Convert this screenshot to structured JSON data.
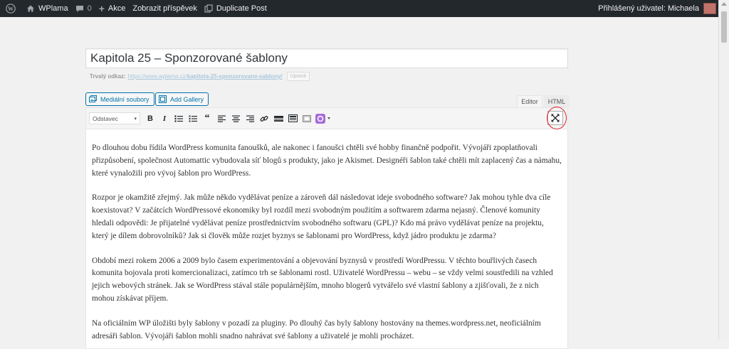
{
  "adminbar": {
    "site_name": "WPlama",
    "comments_count": "0",
    "new_label": "Akce",
    "view_post": "Zobrazit příspěvek",
    "duplicate": "Duplicate Post",
    "user_label": "Přihlášený uživatel: Michaela"
  },
  "post": {
    "title": "Kapitola 25 – Sponzorované šablony",
    "permalink_label": "Trvalý odkaz:",
    "permalink_base": "https://www.wplama.cz/",
    "permalink_slug": "kapitola-25-sponzorovane-sablony/",
    "permalink_button": "Upravit"
  },
  "media": {
    "media_button": "Mediální soubory",
    "gallery_button": "Add Gallery"
  },
  "tabs": {
    "editor": "Editor",
    "html": "HTML"
  },
  "toolbar": {
    "format_selected": "Odstavec"
  },
  "content": {
    "paragraphs": [
      "Po dlouhou dobu řídila WordPress komunita fanoušků, ale nakonec i fanoušci chtěli své hobby finančně podpořit. Vývojáři zpoplatňovali přizpůsobení, společnost Automattic vybudovala síť blogů s produkty, jako je Akismet. Designéři šablon také chtěli mít zaplacený čas a námahu, které vynaložili pro vývoj šablon pro WordPress.",
      "Rozpor je okamžitě zřejmý. Jak může někdo vydělávat peníze a zároveň dál následovat ideje svobodného software? Jak mohou tyhle dva cíle koexistovat? V začátcích WordPressové ekonomiky byl rozdíl mezi svobodným použitím a softwarem zdarma nejasný. Členové komunity hledali odpovědi: Je přijatelné vydělávat peníze prostřednictvím svobodného softwaru (GPL)? Kdo má právo vydělávat peníze na projektu, který je dílem dobrovolníků? Jak si člověk může rozjet byznys se šablonami pro WordPress, když jádro produktu je zdarma?",
      "Období mezi rokem 2006 a 2009 bylo časem experimentování a objevování byznysů v prostředí WordPressu. V těchto bouřlivých časech komunita bojovala proti komercionalizaci, zatímco trh se šablonami rostl. Uživatelé WordPressu – webu – se vždy velmi soustředili na vzhled jejich webových stránek. Jak se WordPress stával stále populárnějším, mnoho blogerů vytvářelo své vlastní šablony a zjišťovali, že z nich mohou získávat příjem.",
      "Na oficiálním WP úložišti byly šablony v pozadí za pluginy. Po dlouhý čas byly šablony hostovány na themes.wordpress.net, neoficiálním adresáři šablon. Vývojáři šablon mohli snadno nahrávat své šablony a uživatelé je mohli procházet."
    ]
  }
}
